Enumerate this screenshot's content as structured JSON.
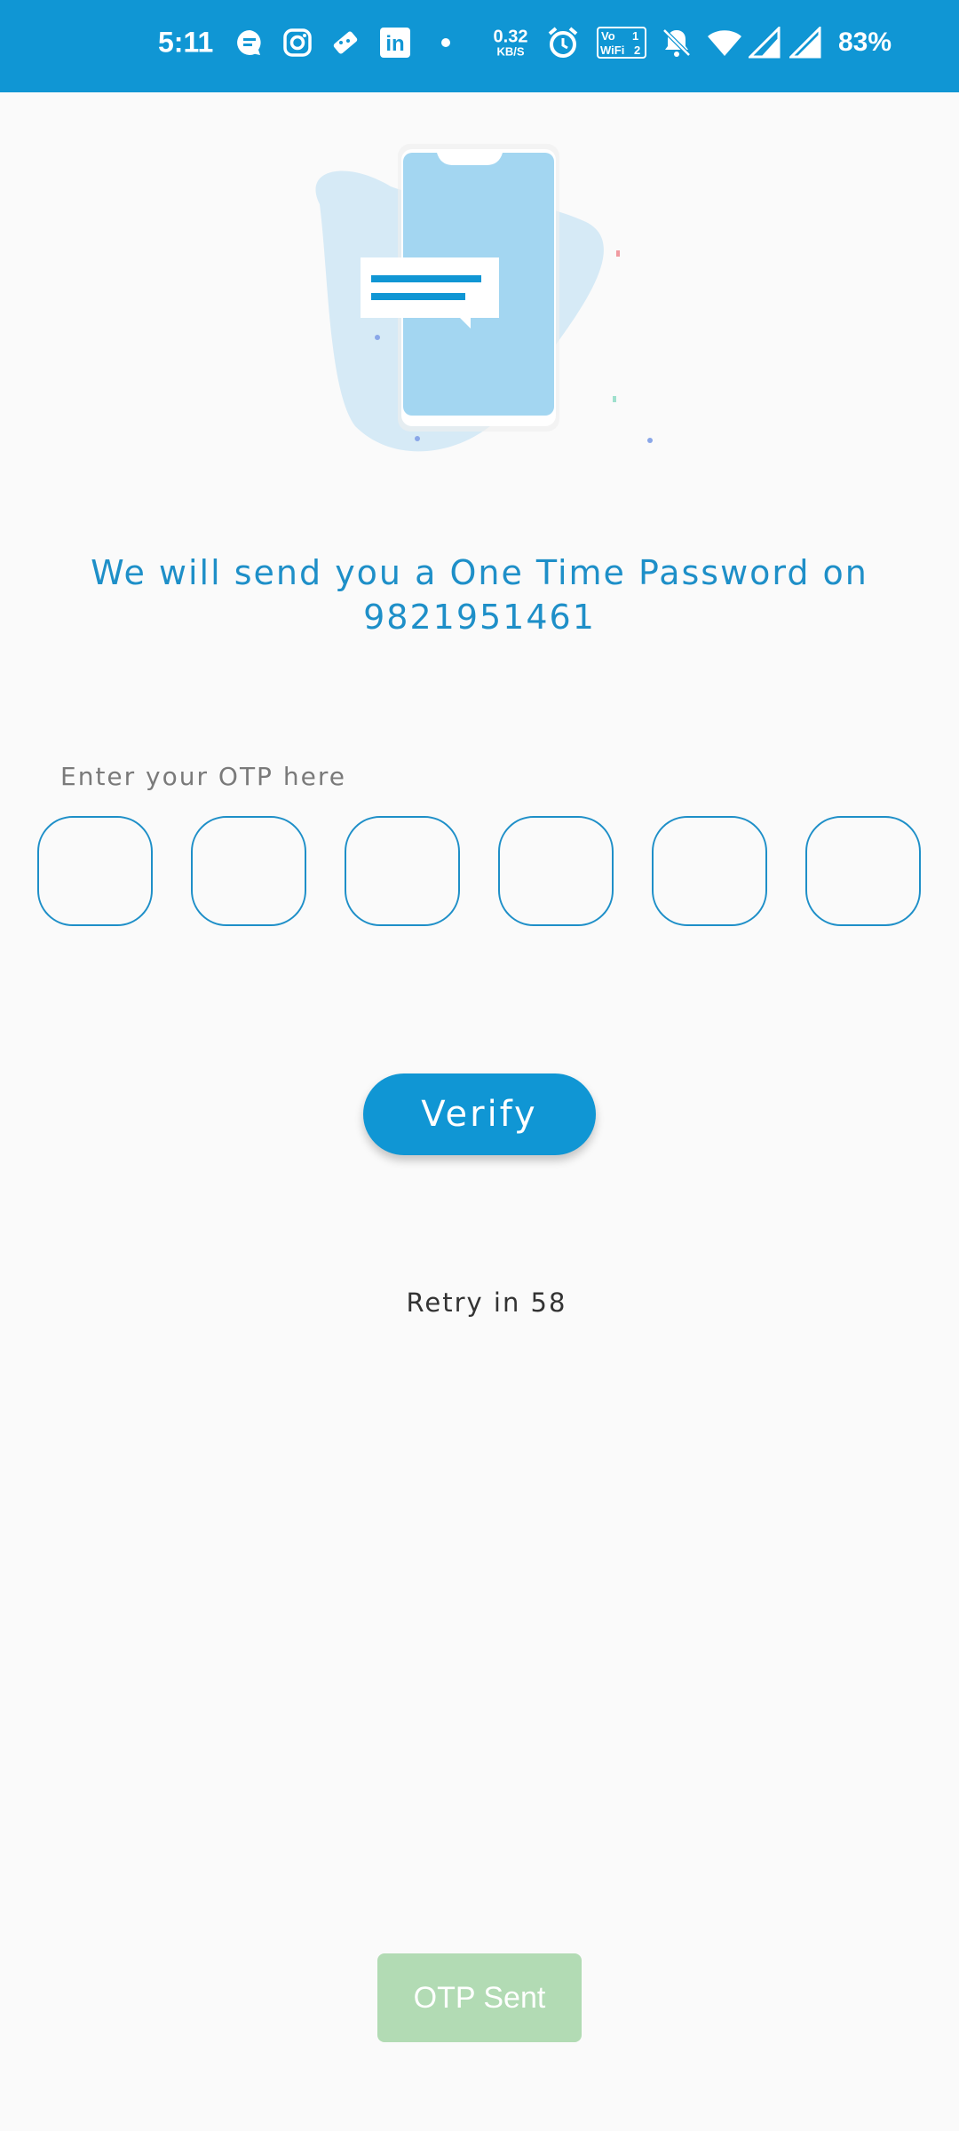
{
  "status_bar": {
    "time": "5:11",
    "speed_value": "0.32",
    "speed_unit": "KB/S",
    "battery": "83%",
    "icons": [
      "message-icon",
      "instagram-icon",
      "game-icon",
      "linkedin-icon",
      "dot-icon",
      "alarm-icon",
      "volte-wifi-icon",
      "mute-icon",
      "wifi-icon",
      "signal-icon",
      "signal-icon"
    ],
    "volte_text_1": "Vo",
    "volte_text_2": "WiFi",
    "volte_text_3": "1",
    "volte_text_4": "2",
    "linkedin_text": "in"
  },
  "headline_line1": "We will send you a One Time Password on",
  "headline_line2": "9821951461",
  "otp": {
    "label": "Enter your OTP here",
    "digits": [
      "",
      "",
      "",
      "",
      "",
      ""
    ]
  },
  "verify_label": "Verify",
  "retry_text": "Retry in 58",
  "otp_sent_label": "OTP Sent",
  "colors": {
    "primary": "#1096d4",
    "accent_text": "#1e8fc8",
    "otp_sent_bg": "#b2dbb4",
    "background": "#fafafa"
  }
}
